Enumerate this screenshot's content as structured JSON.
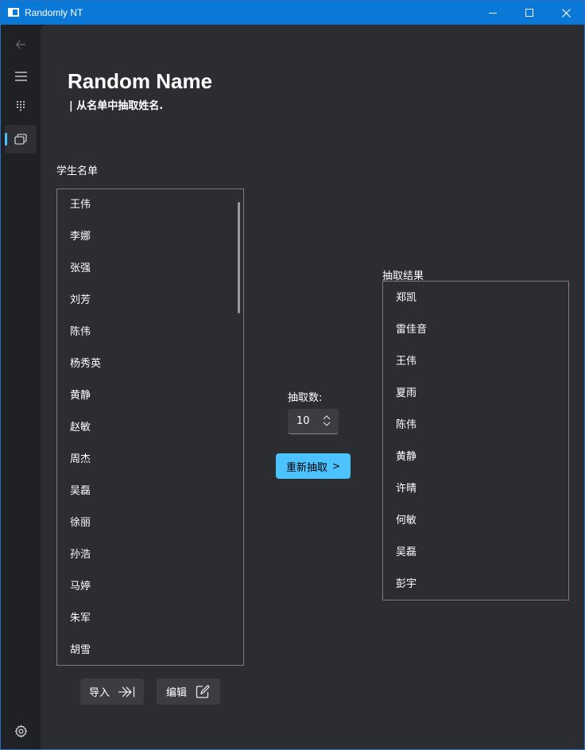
{
  "window": {
    "title": "Randomly NT"
  },
  "nav": {
    "icons": [
      "back-arrow-icon",
      "hamburger-menu-icon",
      "dialpad-icon",
      "random-name-icon",
      "settings-gear-icon"
    ],
    "accent": "#4cc2ff"
  },
  "page": {
    "title": "Random Name",
    "subtitle": "| 从名单中抽取姓名."
  },
  "names": {
    "label": "学生名单",
    "items": [
      "王伟",
      "李娜",
      "张强",
      "刘芳",
      "陈伟",
      "杨秀英",
      "黄静",
      "赵敏",
      "周杰",
      "吴磊",
      "徐丽",
      "孙浩",
      "马婷",
      "朱军",
      "胡雪"
    ]
  },
  "draw": {
    "count_label": "抽取数:",
    "count_value": "10",
    "redraw_label": "重新抽取",
    "redraw_arrow": ">"
  },
  "result": {
    "label": "抽取结果",
    "items": [
      "郑凯",
      "雷佳音",
      "王伟",
      "夏雨",
      "陈伟",
      "黄静",
      "许晴",
      "何敏",
      "吴磊",
      "彭宇"
    ]
  },
  "actions": {
    "import_label": "导入",
    "edit_label": "编辑"
  },
  "colors": {
    "titlebar": "#0a78d7",
    "content_bg": "#2b2d31",
    "accent_button": "#4cc2ff"
  }
}
